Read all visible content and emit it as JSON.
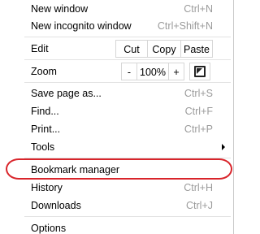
{
  "menu": {
    "new_window": {
      "label": "New window",
      "shortcut": "Ctrl+N"
    },
    "new_incognito": {
      "label": "New incognito window",
      "shortcut": "Ctrl+Shift+N"
    },
    "edit": {
      "label": "Edit",
      "cut": "Cut",
      "copy": "Copy",
      "paste": "Paste"
    },
    "zoom": {
      "label": "Zoom",
      "minus": "-",
      "value": "100%",
      "plus": "+"
    },
    "save_page": {
      "label": "Save page as...",
      "shortcut": "Ctrl+S"
    },
    "find": {
      "label": "Find...",
      "shortcut": "Ctrl+F"
    },
    "print": {
      "label": "Print...",
      "shortcut": "Ctrl+P"
    },
    "tools": {
      "label": "Tools"
    },
    "bookmark_manager": {
      "label": "Bookmark manager"
    },
    "history": {
      "label": "History",
      "shortcut": "Ctrl+H"
    },
    "downloads": {
      "label": "Downloads",
      "shortcut": "Ctrl+J"
    },
    "options": {
      "label": "Options"
    }
  },
  "annotation": {
    "highlight_color": "#d9252b"
  }
}
